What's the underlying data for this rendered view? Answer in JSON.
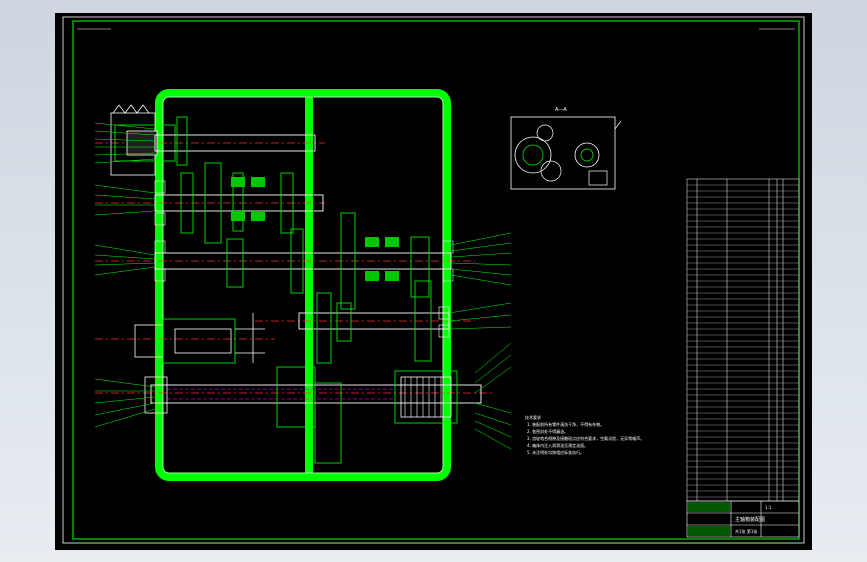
{
  "drawing": {
    "section_label": "A—A",
    "notes_title": "技术要求",
    "notes": [
      "1. 装配前所有零件清洗干净，不得有杂物。",
      "2. 各密封处不得漏油。",
      "3. 齿轮啮合侧隙及接触斑点应符合要求，空载试验，无异常噪声。",
      "4. 箱体内注入润滑油至规定油面。",
      "5. 未注明处均按相应标准执行。"
    ],
    "title_block": {
      "name": "主轴箱装配图",
      "scale": "1:1",
      "sheet": "共1张 第1张"
    },
    "colors": {
      "background": "#000000",
      "frame": "#ffffff",
      "housing": "#00ff00",
      "shaft": "#ffffff",
      "centerline": "#ff3030",
      "gear": "#00e000",
      "leader": "#00ff00",
      "hidden": "#ff00ff"
    }
  }
}
